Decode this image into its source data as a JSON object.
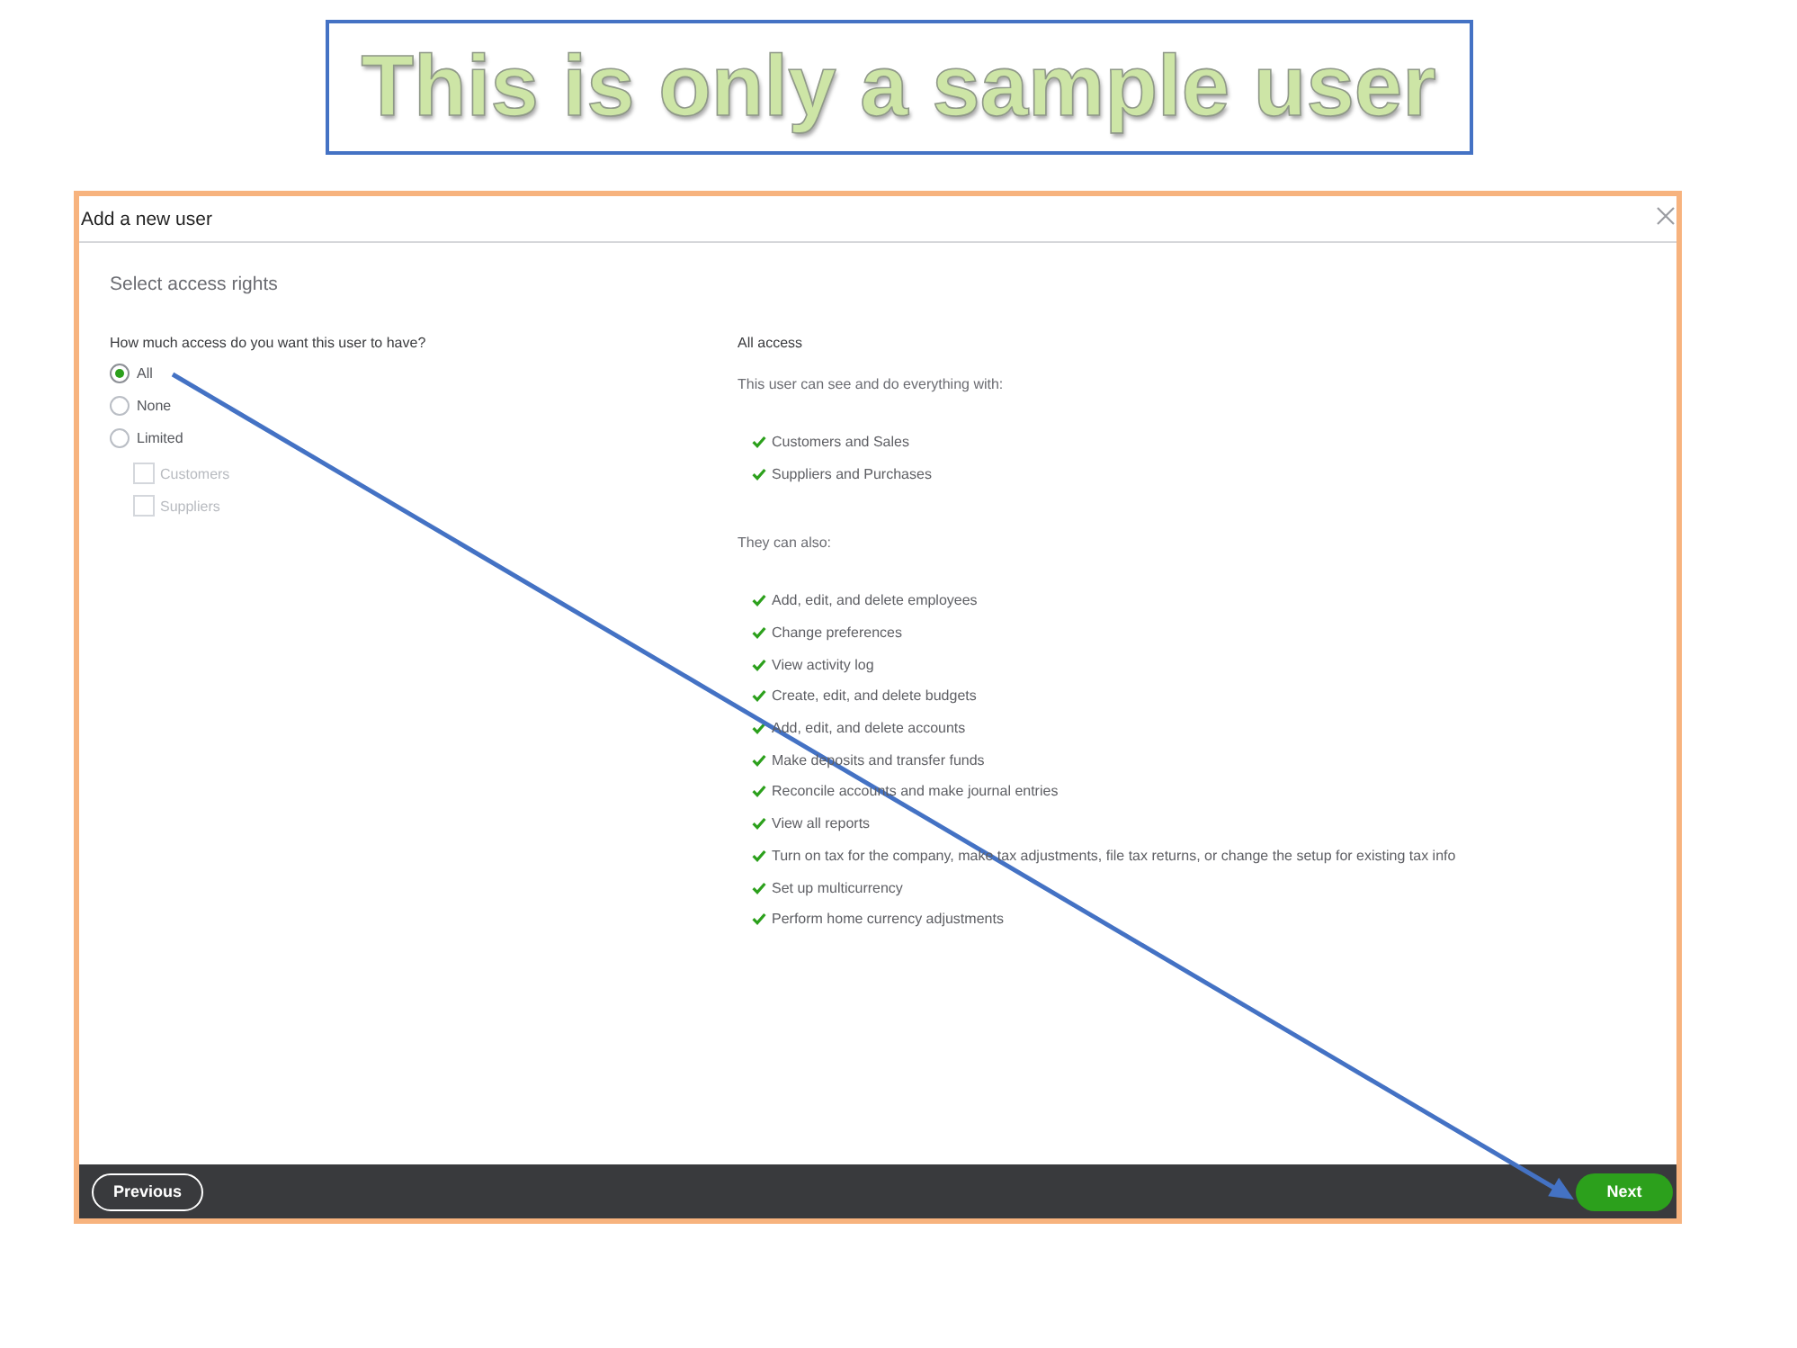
{
  "banner": {
    "text": "This is only a sample user"
  },
  "dialog": {
    "title": "Add a new user",
    "heading": "Select access rights",
    "question": "How much access do you want this user to have?",
    "access_options": [
      {
        "label": "All",
        "selected": true
      },
      {
        "label": "None",
        "selected": false
      },
      {
        "label": "Limited",
        "selected": false
      }
    ],
    "limited_areas": [
      {
        "label": "Customers",
        "checked": false,
        "disabled": true
      },
      {
        "label": "Suppliers",
        "checked": false,
        "disabled": true
      }
    ],
    "summary": {
      "title": "All access",
      "intro": "This user can see and do everything with:",
      "areas": [
        "Customers and Sales",
        "Suppliers and Purchases"
      ],
      "also_label": "They can also:",
      "abilities": [
        "Add, edit, and delete employees",
        "Change preferences",
        "View activity log",
        "Create, edit, and delete budgets",
        "Add, edit, and delete accounts",
        "Make deposits and transfer funds",
        "Reconcile accounts and make journal entries",
        "View all reports",
        "Turn on tax for the company, make tax adjustments, file tax returns, or change the setup for existing tax info",
        "Set up multicurrency",
        "Perform home currency adjustments"
      ]
    },
    "footer": {
      "previous_button": "Previous",
      "next_button": "Next"
    }
  }
}
